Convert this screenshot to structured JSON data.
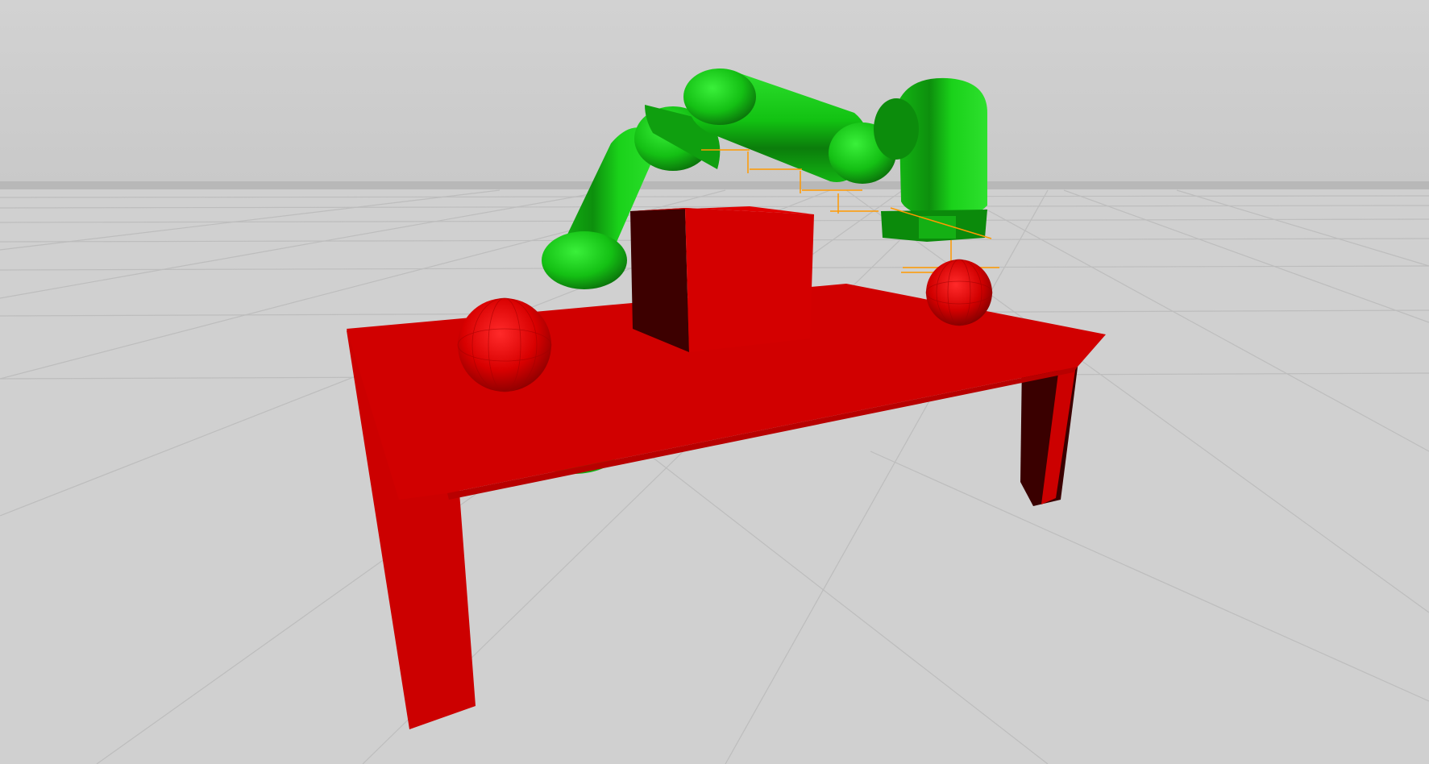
{
  "scene": {
    "type": "3d-simulation-viewport",
    "colors": {
      "sky": "#cfcfcf",
      "horizon_band": "#b7b7b7",
      "floor": "#d0d0d0",
      "grid_line": "#bcbcbc",
      "table_top": "#d20000",
      "table_leg_front": "#cc0000",
      "table_leg_side": "#3f0000",
      "cube_front": "#d40000",
      "cube_side": "#3d0000",
      "sphere": "#dd0000",
      "robot_arm": "#12c212",
      "robot_arm_dark": "#0a7a0a",
      "robot_arm_light": "#2ee02e",
      "frame_marker": "#ff9900"
    },
    "objects": [
      {
        "name": "table",
        "icon": "table-shape"
      },
      {
        "name": "cube",
        "icon": "cube-shape"
      },
      {
        "name": "sphere-left",
        "icon": "sphere-shape"
      },
      {
        "name": "sphere-right",
        "icon": "sphere-shape"
      },
      {
        "name": "robot-arm",
        "icon": "robot-arm-shape"
      }
    ]
  }
}
